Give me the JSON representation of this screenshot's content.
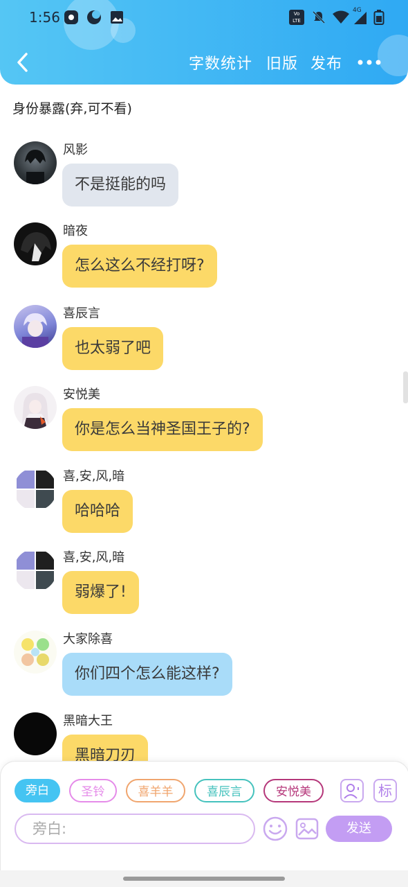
{
  "status_bar": {
    "time": "1:56",
    "network": "4G",
    "volte_label": "Vo LTE"
  },
  "toolbar": {
    "word_count_label": "字数统计",
    "old_version_label": "旧版",
    "publish_label": "发布"
  },
  "chapter_title": "身份暴露(弃,可不看)",
  "messages": [
    {
      "sender": "风影",
      "text": "不是挺能的吗",
      "style": "gray"
    },
    {
      "sender": "暗夜",
      "text": "怎么这么不经打呀?",
      "style": "yellow"
    },
    {
      "sender": "喜辰言",
      "text": "也太弱了吧",
      "style": "yellow"
    },
    {
      "sender": "安悦美",
      "text": "你是怎么当神圣国王子的?",
      "style": "yellow"
    },
    {
      "sender": "喜,安,风,暗",
      "text": "哈哈哈",
      "style": "yellow"
    },
    {
      "sender": "喜,安,风,暗",
      "text": "弱爆了!",
      "style": "yellow"
    },
    {
      "sender": "大家除喜",
      "text": "你们四个怎么能这样?",
      "style": "blue"
    },
    {
      "sender": "黑暗大王",
      "text": "黑暗刀刃",
      "style": "yellow"
    }
  ],
  "role_chips": [
    {
      "label": "旁白",
      "selected": true,
      "color": "#45c4f2"
    },
    {
      "label": "圣铃",
      "selected": false,
      "color": "#e58be9"
    },
    {
      "label": "喜羊羊",
      "selected": false,
      "color": "#f0a56e"
    },
    {
      "label": "喜辰言",
      "selected": false,
      "color": "#45c2bd"
    },
    {
      "label": "安悦美",
      "selected": false,
      "color": "#b5377a"
    }
  ],
  "tag_button_label": "标",
  "input": {
    "placeholder": "旁白:"
  },
  "send_label": "发送",
  "colors": {
    "header_start": "#55c6f4",
    "header_end": "#2fa9f3",
    "bubble_gray": "#e1e6ee",
    "bubble_yellow": "#fcd968",
    "bubble_blue": "#a9dcf9",
    "send_button": "#c39df3"
  },
  "icons": [
    "back-arrow-icon",
    "more-icon",
    "bell-muted-icon",
    "wifi-icon",
    "signal-icon",
    "battery-icon",
    "emoji-icon",
    "image-icon",
    "character-icon"
  ]
}
